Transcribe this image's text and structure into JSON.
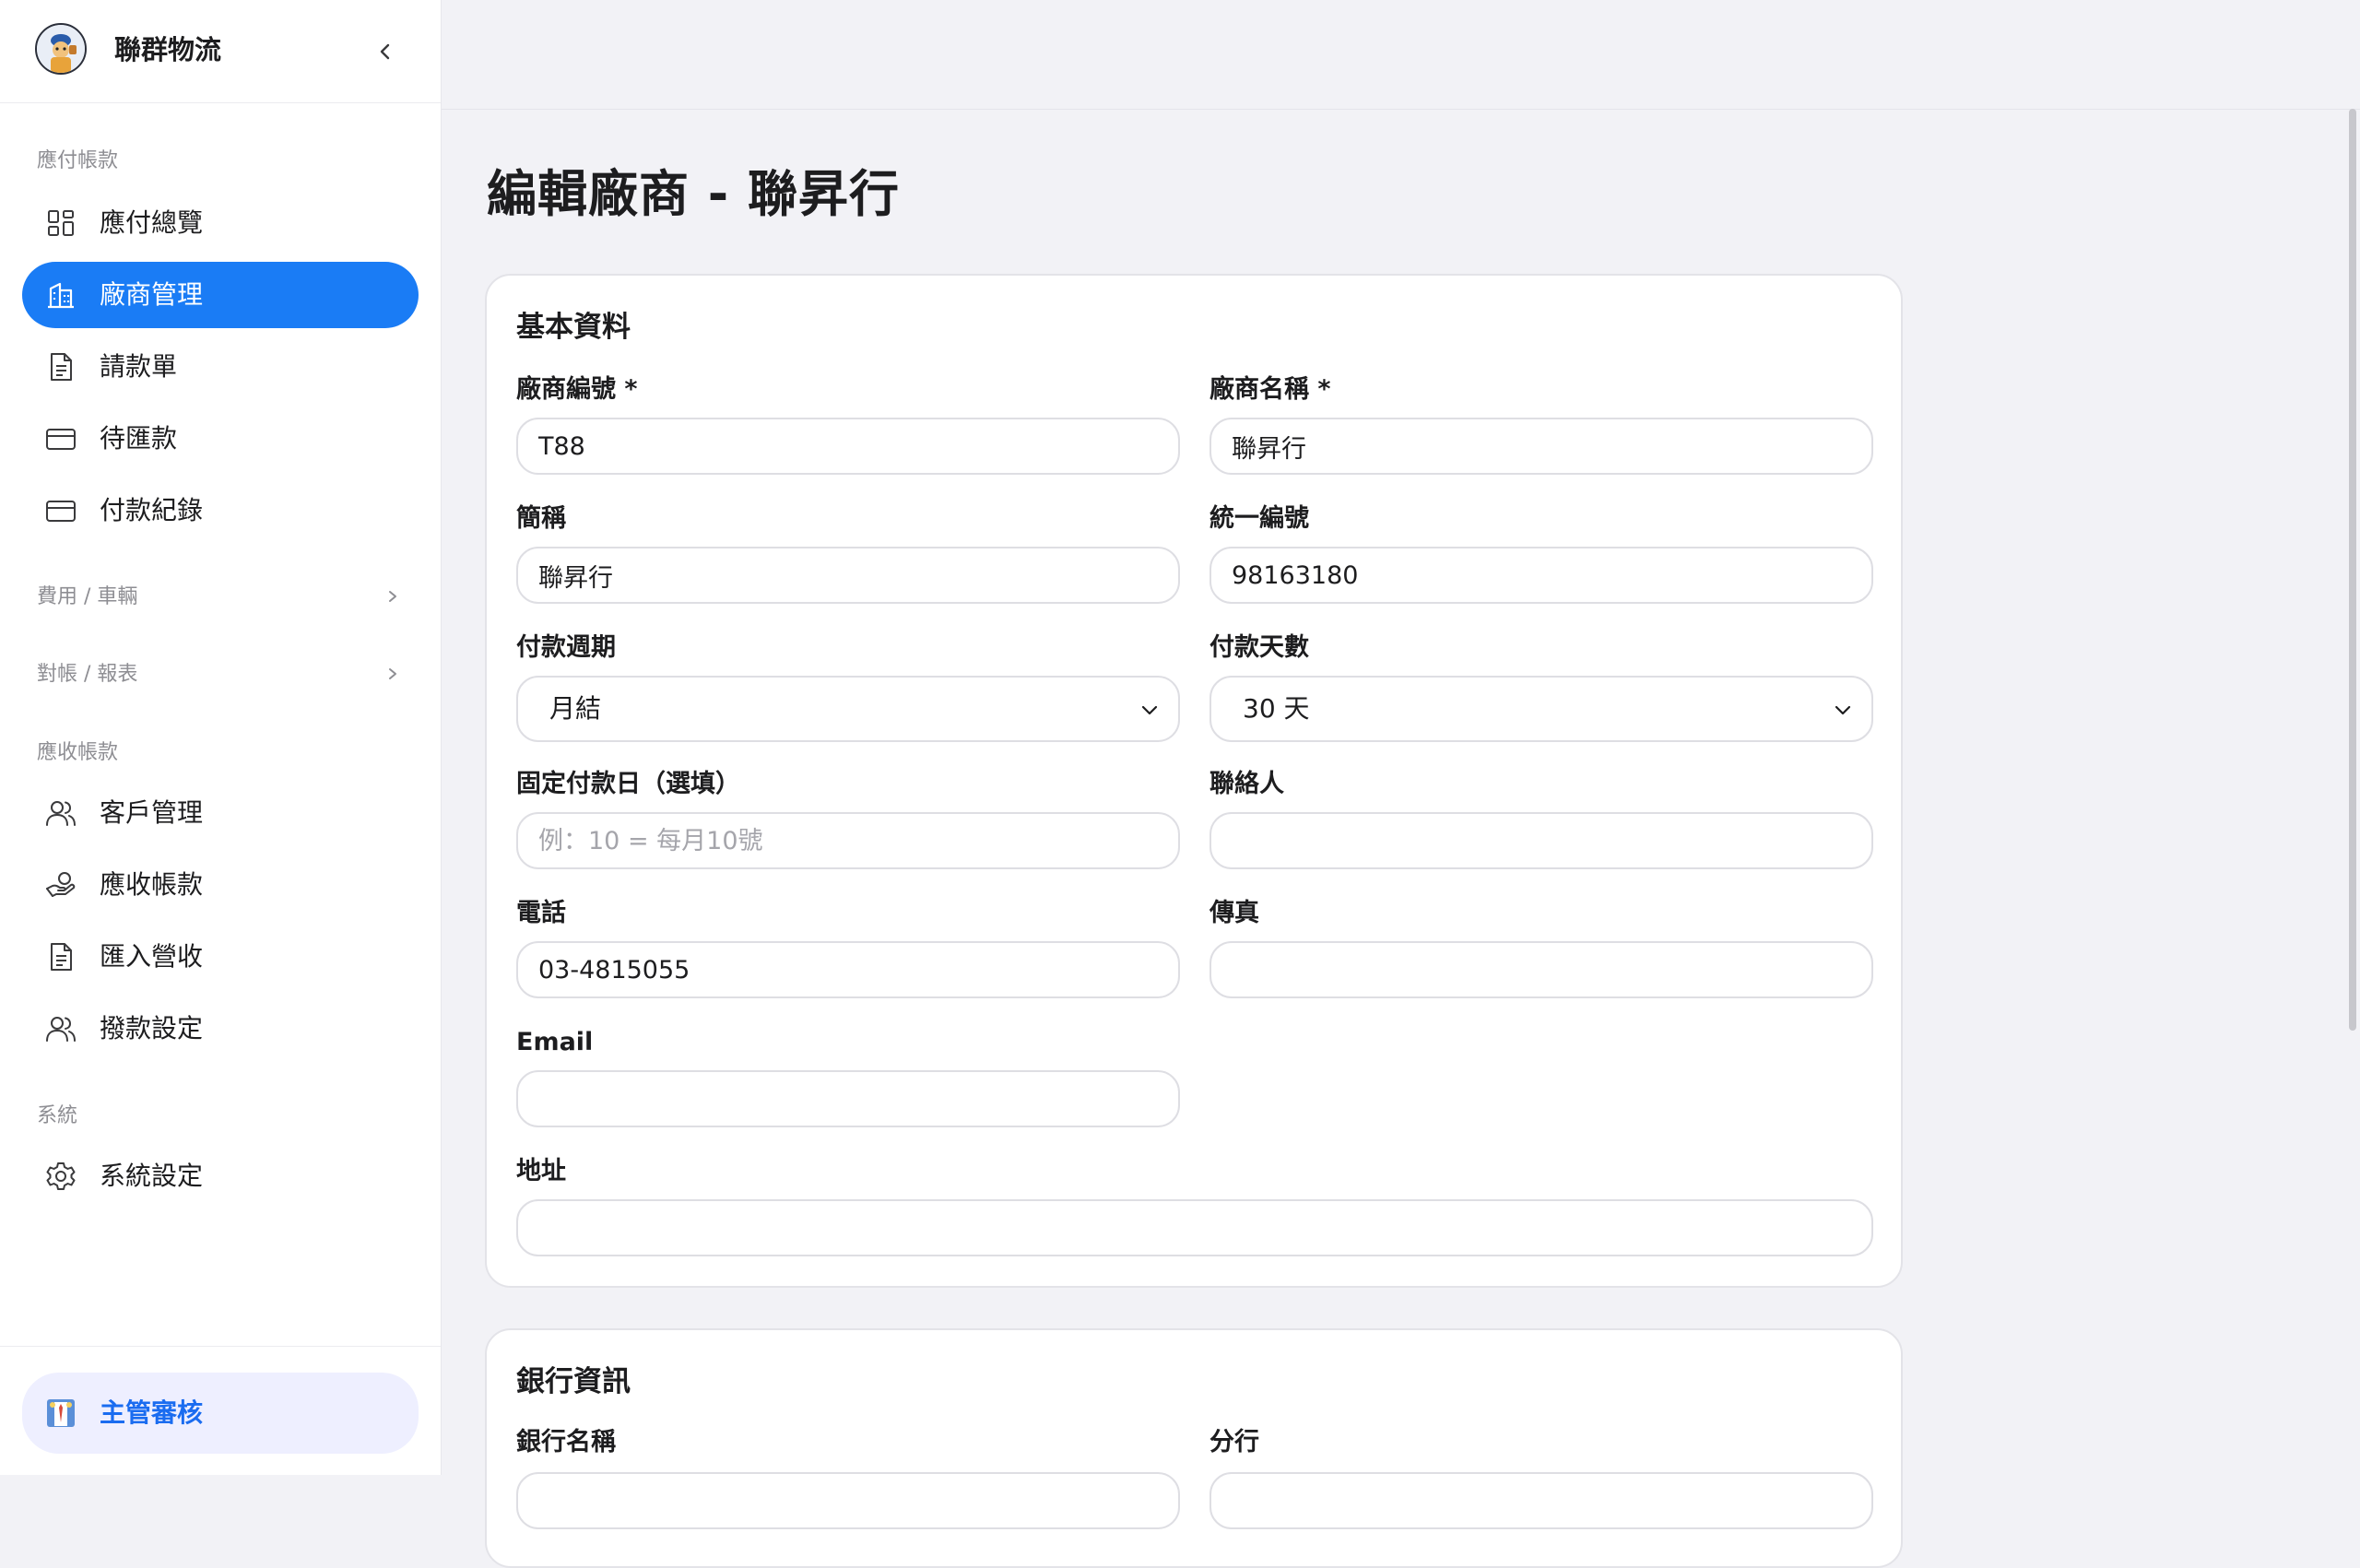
{
  "app": {
    "name": "聯群物流"
  },
  "sidebar": {
    "payables_header": "應付帳款",
    "payables_items": [
      {
        "label": "應付總覽",
        "icon": "grid-icon"
      },
      {
        "label": "廠商管理",
        "icon": "building-icon",
        "active": true
      },
      {
        "label": "請款單",
        "icon": "document-icon"
      },
      {
        "label": "待匯款",
        "icon": "credit-card-icon"
      },
      {
        "label": "付款紀錄",
        "icon": "credit-card-icon"
      }
    ],
    "group_expenses": "費用 / 車輛",
    "group_reconcile": "對帳 / 報表",
    "receivables_header": "應收帳款",
    "receivables_items": [
      {
        "label": "客戶管理",
        "icon": "users-icon"
      },
      {
        "label": "應收帳款",
        "icon": "hand-coin-icon"
      },
      {
        "label": "匯入營收",
        "icon": "document-icon"
      },
      {
        "label": "撥款設定",
        "icon": "users-icon"
      }
    ],
    "system_header": "系統",
    "system_items": [
      {
        "label": "系統設定",
        "icon": "gear-icon"
      }
    ],
    "review_button": "主管審核"
  },
  "page": {
    "title": "編輯廠商 - 聯昇行"
  },
  "basic": {
    "title": "基本資料",
    "vendor_code_label": "廠商編號 *",
    "vendor_code_value": "T88",
    "vendor_name_label": "廠商名稱 *",
    "vendor_name_value": "聯昇行",
    "short_name_label": "簡稱",
    "short_name_value": "聯昇行",
    "tax_id_label": "統一編號",
    "tax_id_value": "98163180",
    "payment_cycle_label": "付款週期",
    "payment_cycle_value": "月結",
    "payment_days_label": "付款天數",
    "payment_days_value": "30 天",
    "fixed_day_label": "固定付款日（選填）",
    "fixed_day_placeholder": "例：10 = 每月10號",
    "fixed_day_value": "",
    "contact_label": "聯絡人",
    "contact_value": "",
    "phone_label": "電話",
    "phone_value": "03-4815055",
    "fax_label": "傳真",
    "fax_value": "",
    "email_label": "Email",
    "email_value": "",
    "address_label": "地址",
    "address_value": ""
  },
  "bank": {
    "title": "銀行資訊",
    "bank_name_label": "銀行名稱",
    "branch_label": "分行"
  },
  "colors": {
    "accent": "#1a7cf5",
    "review_bg": "#eeefff",
    "page_bg": "#f2f2f6"
  }
}
